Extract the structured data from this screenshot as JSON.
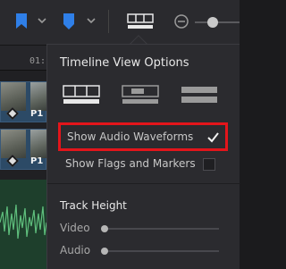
{
  "timeline": {
    "ruler_text": "01:",
    "clips": [
      {
        "label": "P1"
      },
      {
        "label": "P1"
      }
    ]
  },
  "popup": {
    "title": "Timeline View Options",
    "options": [
      {
        "label": "Show Audio Waveforms",
        "checked": true
      },
      {
        "label": "Show Flags and Markers",
        "checked": false
      }
    ],
    "track_height": {
      "title": "Track Height",
      "sliders": [
        {
          "label": "Video",
          "value": 0
        },
        {
          "label": "Audio",
          "value": 0
        }
      ]
    },
    "check_mark": "✔"
  },
  "colors": {
    "accent_blue": "#2f7fe8",
    "highlight_red": "#e3151b"
  }
}
